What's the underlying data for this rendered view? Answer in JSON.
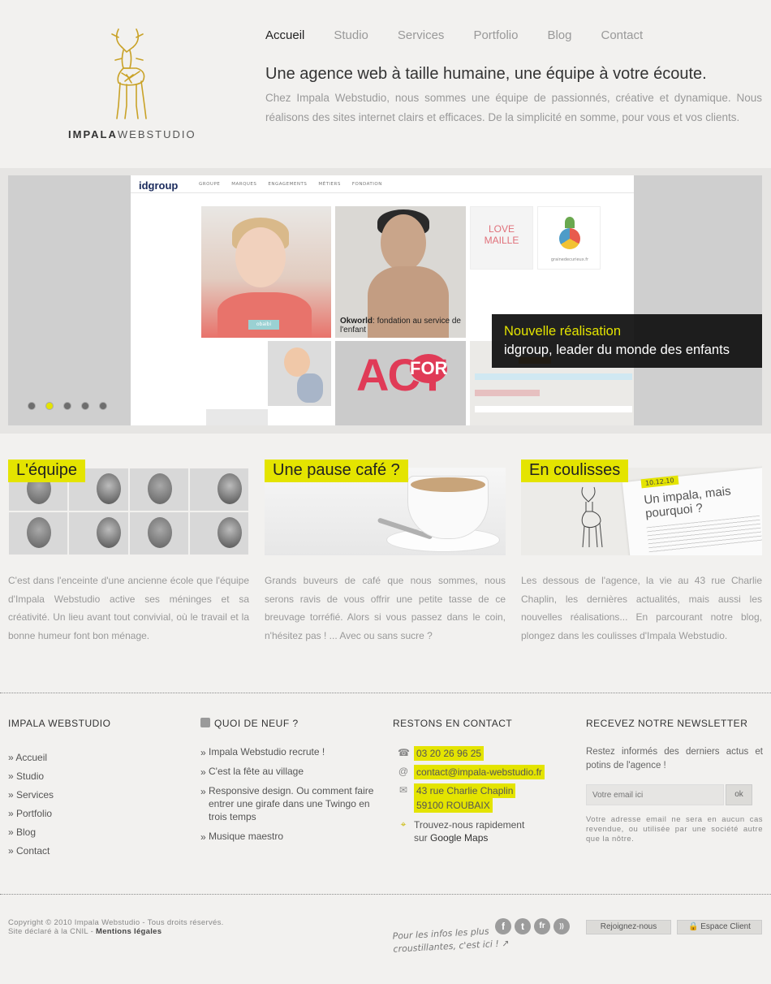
{
  "brand": {
    "name_bold": "IMPALA",
    "name_light": "WEBSTUDIO"
  },
  "nav": [
    {
      "label": "Accueil",
      "active": true
    },
    {
      "label": "Studio"
    },
    {
      "label": "Services"
    },
    {
      "label": "Portfolio"
    },
    {
      "label": "Blog"
    },
    {
      "label": "Contact"
    }
  ],
  "intro": {
    "title": "Une agence web à taille humaine, une équipe à votre écoute.",
    "text": "Chez Impala Webstudio, nous sommes une équipe de passionnés, créative et dynamique. Nous réalisons des sites internet clairs et efficaces. De la simplicité en somme, pour vous et vos clients."
  },
  "slider": {
    "caption_line1": "Nouvelle réalisation",
    "caption_line2": "idgroup, leader du monde des enfants",
    "dots_count": 5,
    "active_dot": 1,
    "screenshot": {
      "logo": "idgroup",
      "menu": [
        "GROUPE",
        "MARQUES",
        "ENGAGEMENTS",
        "MÉTIERS",
        "FONDATION"
      ],
      "tile_caption_bold": "Okworld",
      "tile_caption": ": fondation au service de l'enfant",
      "love_maille": "LOVE MAILLE",
      "graine": "grainedecurieux.fr",
      "act": "ACT",
      "for": "FOR",
      "obaibi": "obaibi"
    }
  },
  "features": [
    {
      "title": "L'équipe",
      "text": "C'est dans l'enceinte d'une ancienne école que l'équipe d'Impala Webstudio active ses méninges et sa créativité. Un lieu avant tout convivial, où le travail et la bonne humeur font bon ménage."
    },
    {
      "title": "Une pause café ?",
      "text": "Grands buveurs de café que nous sommes, nous serons ravis de vous offrir une petite tasse de ce breuvage torréfié. Alors si vous passez dans le coin, n'hésitez pas ! ... Avec ou sans sucre ?"
    },
    {
      "title": "En coulisses",
      "text": "Les dessous de l'agence, la vie au 43 rue Charlie Chaplin, les dernières actualités, mais aussi les nouvelles réalisations... En parcourant notre blog, plongez dans les coulisses d'Impala Webstudio.",
      "paper_date": "10.12.10",
      "paper_title": "Un impala, mais pourquoi ?"
    }
  ],
  "footer": {
    "col1": {
      "title": "IMPALA WEBSTUDIO",
      "links": [
        "» Accueil",
        "» Studio",
        "» Services",
        "» Portfolio",
        "» Blog",
        "» Contact"
      ]
    },
    "col2": {
      "title": "QUOI DE NEUF ?",
      "posts": [
        "Impala Webstudio recrute !",
        "C'est la fête au village",
        "Responsive design. Ou comment faire entrer une girafe dans une Twingo en trois temps",
        "Musique maestro"
      ]
    },
    "col3": {
      "title": "RESTONS EN CONTACT",
      "phone": "03 20 26 96 25",
      "email": "contact@impala-webstudio.fr",
      "address1": "43 rue Charlie Chaplin",
      "address2": "59100 ROUBAIX",
      "map_line1": "Trouvez-nous rapidement",
      "map_line2_prefix": "sur ",
      "map_line2_link": "Google Maps"
    },
    "col4": {
      "title": "RECEVEZ NOTRE NEWSLETTER",
      "lead": "Restez informés des derniers actus et potins de l'agence !",
      "placeholder": "Votre email ici",
      "ok": "ok",
      "note": "Votre adresse email ne sera en aucun cas revendue, ou utilisée par une société autre que la nôtre."
    },
    "copyright_line1": "Copyright © 2010 Impala Webstudio - Tous droits réservés.",
    "copyright_line2_prefix": "Site déclaré à la CNIL - ",
    "copyright_line2_link": "Mentions légales",
    "social_note_line1": "Pour les infos les plus",
    "social_note_line2": "croustillantes, c'est ici !",
    "socials": [
      "f",
      "t",
      "fr",
      "rss"
    ],
    "join": "Rejoignez-nous",
    "espace_client": "Espace Client"
  },
  "colors": {
    "accent": "#e4e400",
    "background": "#f2f1ef",
    "text": "#666666"
  }
}
